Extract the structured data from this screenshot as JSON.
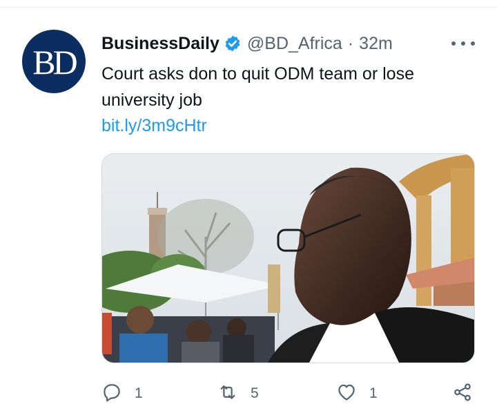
{
  "tweet": {
    "avatar_text": "BD",
    "display_name": "BusinessDaily",
    "handle": "@BD_Africa",
    "separator": "·",
    "time": "32m",
    "text": "Court asks don to quit ODM team or lose university job",
    "link": "bit.ly/3m9cHtr",
    "icons": [
      "verified-badge-icon",
      "more-options-icon",
      "reply-icon",
      "retweet-icon",
      "like-icon",
      "share-icon"
    ],
    "actions": {
      "replies": "1",
      "retweets": "5",
      "likes": "1"
    }
  },
  "colors": {
    "brand": "#0c2d62",
    "link": "#1d9bf0",
    "secondary_text": "#536471"
  }
}
